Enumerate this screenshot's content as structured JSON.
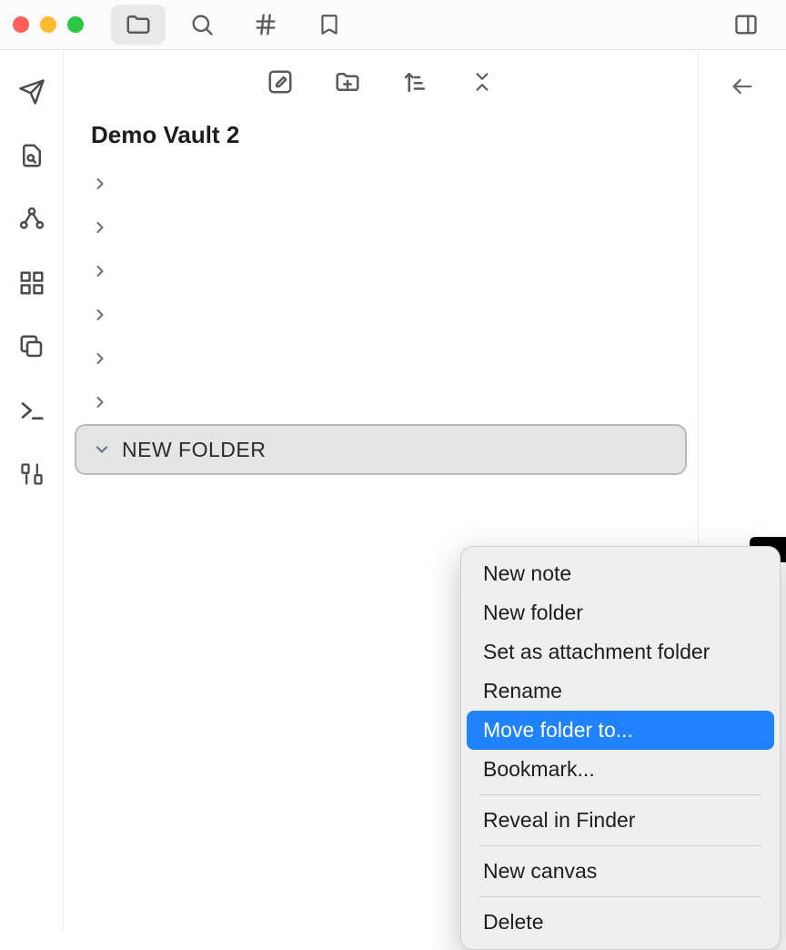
{
  "toolbar": {
    "files_tab": "Files",
    "search_tab": "Search",
    "tags_tab": "Tags",
    "bookmarks_tab": "Bookmarks",
    "panel_toggle": "Toggle right panel"
  },
  "ribbon": {
    "quick_switcher": "Quick switcher",
    "search_replace": "Search in file",
    "graph": "Graph view",
    "canvas": "Canvas",
    "copy": "Copy",
    "command": "Command",
    "developer": "Developer"
  },
  "sidebar": {
    "vault_title": "Demo Vault 2",
    "new_note": "New note",
    "new_folder": "New folder",
    "sort": "Sort",
    "collapse": "Collapse",
    "tree": [
      {
        "label": ""
      },
      {
        "label": ""
      },
      {
        "label": ""
      },
      {
        "label": ""
      },
      {
        "label": ""
      },
      {
        "label": ""
      }
    ],
    "selected_folder": "NEW FOLDER"
  },
  "editor": {
    "back": "Back"
  },
  "context_menu": {
    "items": [
      {
        "label": "New note"
      },
      {
        "label": "New folder"
      },
      {
        "label": "Set as attachment folder"
      },
      {
        "label": "Rename"
      },
      {
        "label": "Move folder to...",
        "highlight": true
      },
      {
        "label": "Bookmark..."
      },
      {
        "sep": true
      },
      {
        "label": "Reveal in Finder"
      },
      {
        "sep": true
      },
      {
        "label": "New canvas"
      },
      {
        "sep": true
      },
      {
        "label": "Delete"
      }
    ]
  }
}
